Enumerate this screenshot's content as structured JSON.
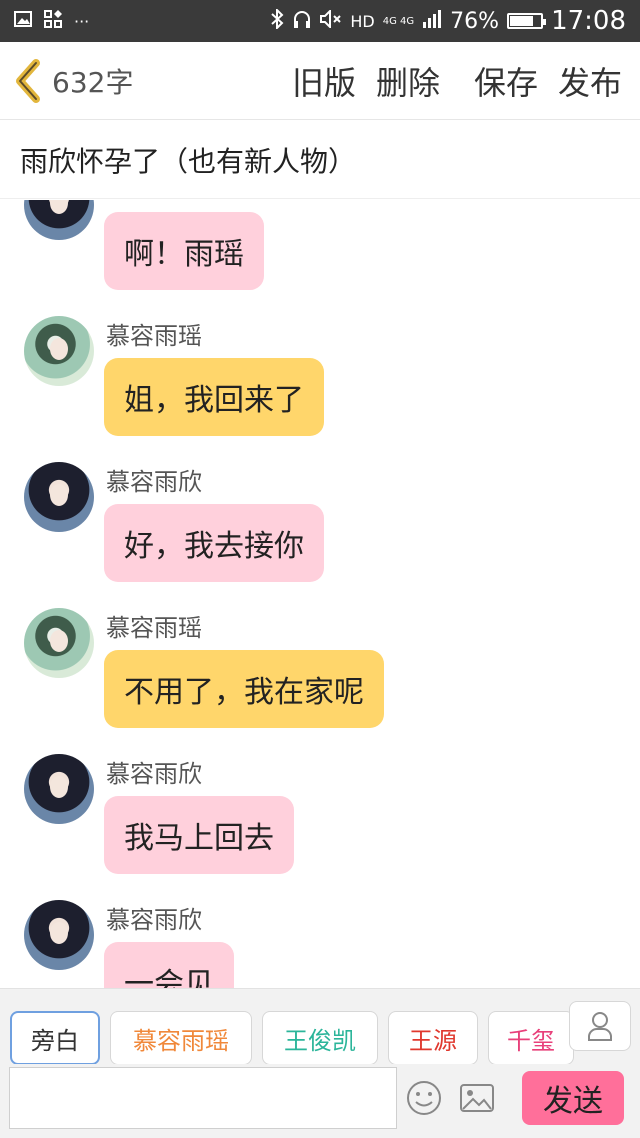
{
  "status_bar": {
    "network": "HD",
    "network_type": "4G 4G",
    "battery_pct": "76%",
    "battery_level": 0.76,
    "time": "17:08",
    "icons": [
      "image-icon",
      "apps-icon",
      "more-icon",
      "bluetooth-icon",
      "headset-icon",
      "mute-icon",
      "signal-icon",
      "battery-icon"
    ]
  },
  "header": {
    "word_count": "632字",
    "actions": {
      "old_version": "旧版",
      "delete": "删除",
      "save": "保存",
      "publish": "发布"
    }
  },
  "story_title": "雨欣怀孕了（也有新人物）",
  "messages": [
    {
      "speaker": "",
      "avatar": "yuxin",
      "text": "啊！雨瑶",
      "color": "pink"
    },
    {
      "speaker": "慕容雨瑶",
      "avatar": "yuyao",
      "text": "姐，我回来了",
      "color": "yellow"
    },
    {
      "speaker": "慕容雨欣",
      "avatar": "yuxin",
      "text": "好，我去接你",
      "color": "pink"
    },
    {
      "speaker": "慕容雨瑶",
      "avatar": "yuyao",
      "text": "不用了，我在家呢",
      "color": "yellow"
    },
    {
      "speaker": "慕容雨欣",
      "avatar": "yuxin",
      "text": "我马上回去",
      "color": "pink"
    },
    {
      "speaker": "慕容雨欣",
      "avatar": "yuxin",
      "text": "一会见",
      "color": "pink"
    }
  ],
  "characters": [
    {
      "label": "旁白",
      "color": "#333333"
    },
    {
      "label": "慕容雨瑶",
      "color": "#f0883a"
    },
    {
      "label": "王俊凯",
      "color": "#2bb59a"
    },
    {
      "label": "王源",
      "color": "#e0382e"
    },
    {
      "label": "千玺",
      "color": "#e8407a"
    }
  ],
  "input": {
    "value": "",
    "placeholder": "",
    "send_label": "发送"
  },
  "colors": {
    "pink_bubble": "#ffd0dc",
    "yellow_bubble": "#ffd66b",
    "send_button": "#ff6f9a"
  }
}
